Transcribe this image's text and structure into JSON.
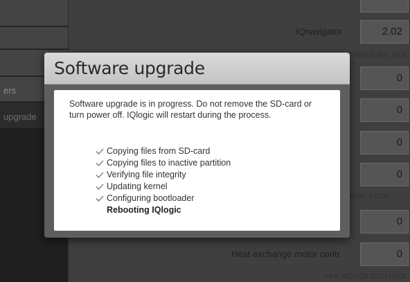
{
  "sidebar": {
    "items": [
      {
        "label": ""
      },
      {
        "label": ""
      },
      {
        "label": ""
      },
      {
        "label": "ers"
      },
      {
        "label": "upgrade"
      }
    ]
  },
  "main": {
    "rows": [
      {
        "label": "",
        "value": ""
      },
      {
        "label": "IQnavigator",
        "value": "2.02"
      },
      {
        "label": "",
        "value": "0"
      },
      {
        "label": "",
        "value": "0"
      },
      {
        "label": "",
        "value": "0"
      },
      {
        "label": "",
        "value": "0"
      },
      {
        "label": "",
        "value": "0"
      },
      {
        "label": "Heat exchange motor contr.",
        "value": "0"
      }
    ],
    "sections": [
      {
        "label": "PRESSURE SEN"
      },
      {
        "label": "HEAT EXCH"
      },
      {
        "label": "FAN MOTOR CONTROL"
      }
    ]
  },
  "modal": {
    "title": "Software upgrade",
    "message": "Software upgrade is in progress. Do not remove the SD-card or turn power off. IQlogic will restart during the process.",
    "steps": [
      {
        "label": "Copying files from SD-card",
        "status": "done",
        "icon": "check-icon"
      },
      {
        "label": "Copying files to inactive partition",
        "status": "done",
        "icon": "check-icon"
      },
      {
        "label": "Verifying file integrity",
        "status": "done",
        "icon": "check-icon"
      },
      {
        "label": "Updating kernel",
        "status": "done",
        "icon": "check-icon"
      },
      {
        "label": "Configuring bootloader",
        "status": "done",
        "icon": "check-icon"
      },
      {
        "label": "Rebooting IQlogic",
        "status": "in-progress"
      }
    ]
  },
  "colors": {
    "overlay_dim": "#3f3f3f",
    "modal_frame": "#5e5e5e",
    "modal_title_bar": "#cfcfcf",
    "check_color": "#8a8a8a"
  }
}
